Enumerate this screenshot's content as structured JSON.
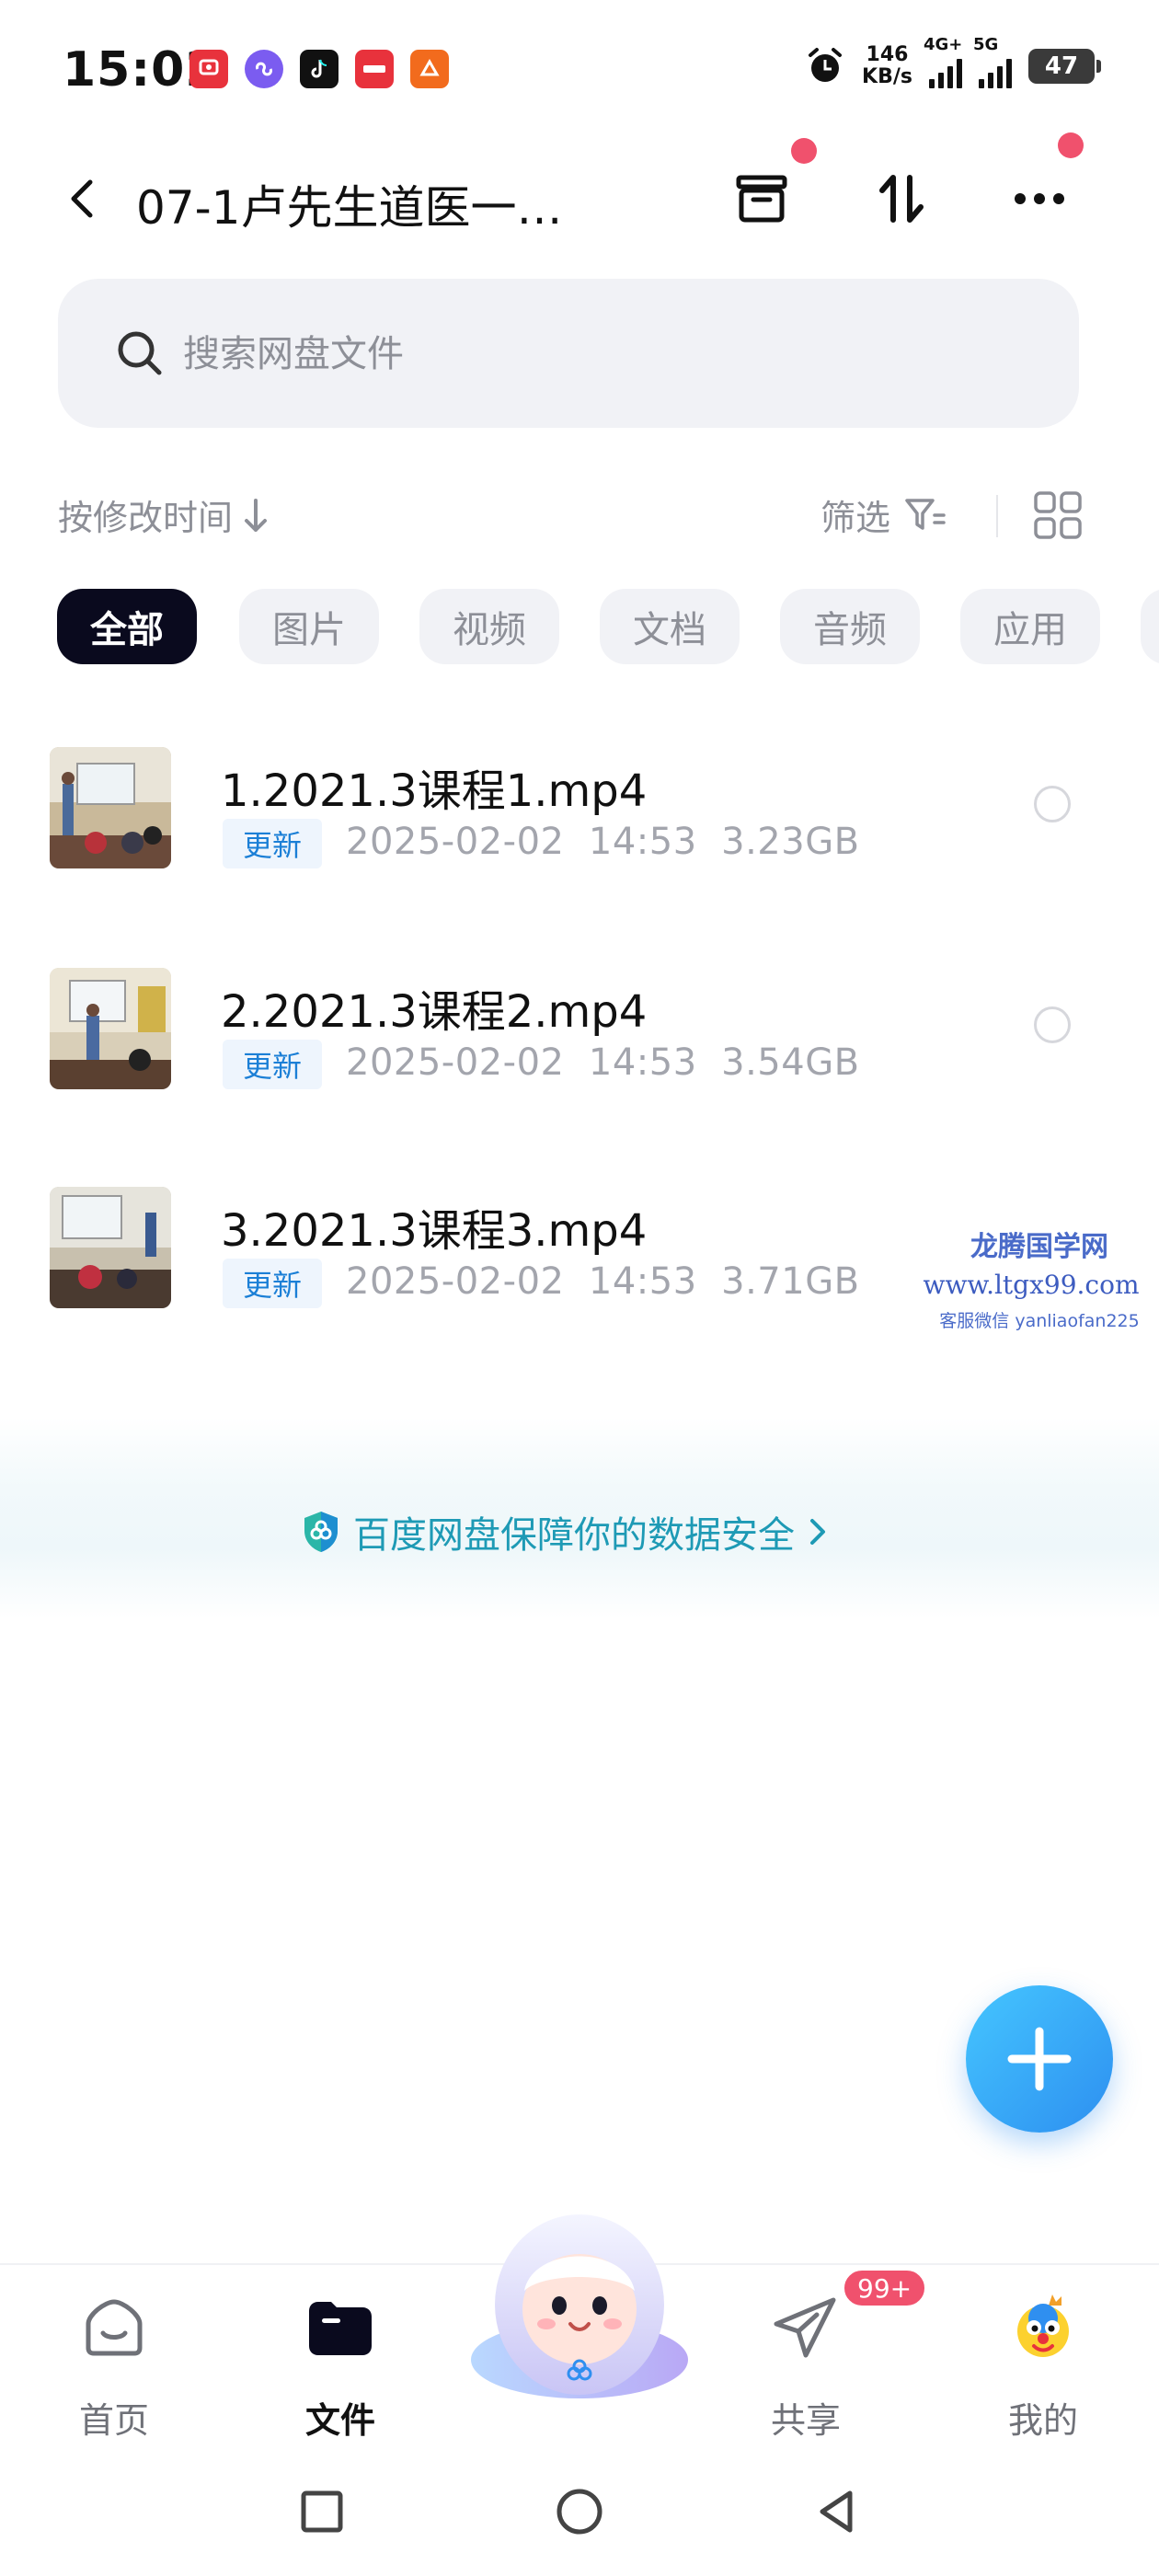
{
  "status_bar": {
    "time": "15:02",
    "speed_value": "146",
    "speed_unit": "KB/s",
    "net1": "4G+",
    "net2": "5G",
    "battery": "47"
  },
  "nav": {
    "title": "07-1卢先生道医一…"
  },
  "search": {
    "placeholder": "搜索网盘文件"
  },
  "sort": {
    "label": "按修改时间",
    "filter_label": "筛选"
  },
  "tabs": [
    {
      "label": "全部",
      "active": true
    },
    {
      "label": "图片"
    },
    {
      "label": "视频"
    },
    {
      "label": "文档"
    },
    {
      "label": "音频"
    },
    {
      "label": "应用"
    }
  ],
  "files": [
    {
      "name": "1.2021.3课程1.mp4",
      "badge": "更新",
      "date": "2025-02-02",
      "time": "14:53",
      "size": "3.23GB"
    },
    {
      "name": "2.2021.3课程2.mp4",
      "badge": "更新",
      "date": "2025-02-02",
      "time": "14:53",
      "size": "3.54GB"
    },
    {
      "name": "3.2021.3课程3.mp4",
      "badge": "更新",
      "date": "2025-02-02",
      "time": "14:53",
      "size": "3.71GB"
    }
  ],
  "watermark": {
    "line1": "龙腾国学网",
    "line2": "www.ltgx99.com",
    "line3": "客服微信 yanliaofan225"
  },
  "safety_banner": {
    "text": "百度网盘保障你的数据安全"
  },
  "bottom_nav": {
    "home": "首页",
    "files": "文件",
    "share": "共享",
    "share_badge": "99+",
    "mine": "我的"
  },
  "colors": {
    "accent": "#2d8ff0",
    "badge_red": "#f0516d",
    "update_blue": "#1b7fd6",
    "safety_teal": "#1e9ab5",
    "active_tab": "#0a0a1e"
  }
}
